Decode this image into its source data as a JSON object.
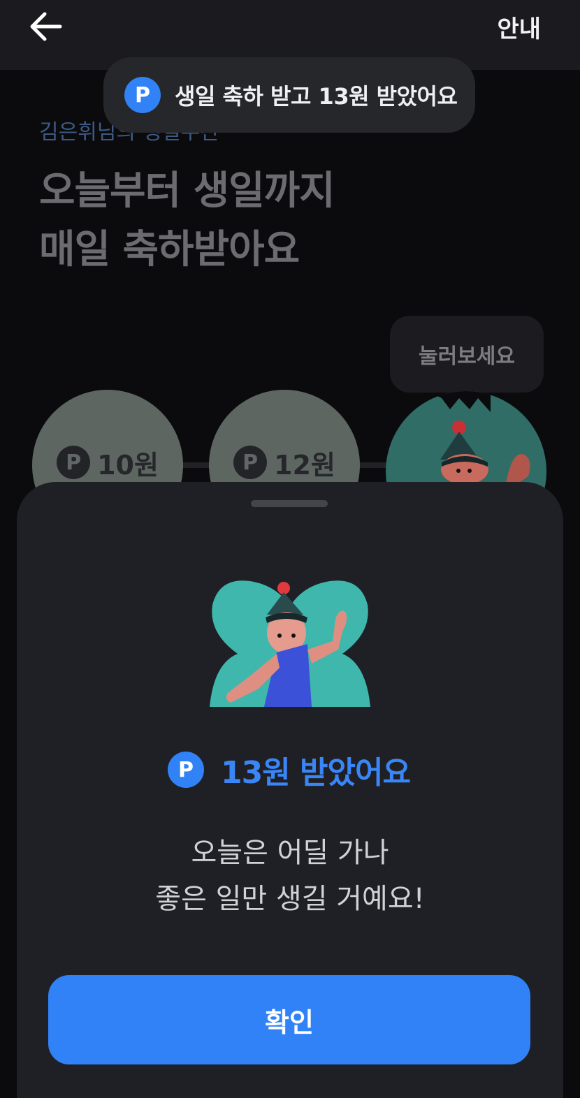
{
  "header": {
    "guide_label": "안내"
  },
  "intro": {
    "subtitle": "김은휘님의 생일주간",
    "title_line1": "오늘부터 생일까지",
    "title_line2": "매일 축하받아요"
  },
  "tooltip": {
    "text": "눌러보세요"
  },
  "days": [
    {
      "point_icon": "P",
      "amount": "10원"
    },
    {
      "point_icon": "P",
      "amount": "12원"
    }
  ],
  "toast": {
    "point_icon": "P",
    "text": "생일 축하 받고 13원 받았어요"
  },
  "sheet": {
    "point_icon": "P",
    "reward_text": "13원 받았어요",
    "message_line1": "오늘은 어딜 가나",
    "message_line2": "좋은 일만 생길 거예요!",
    "confirm_label": "확인"
  },
  "colors": {
    "accent": "#3182f6",
    "background": "#0b0b0d",
    "sheet": "#1f2025"
  }
}
